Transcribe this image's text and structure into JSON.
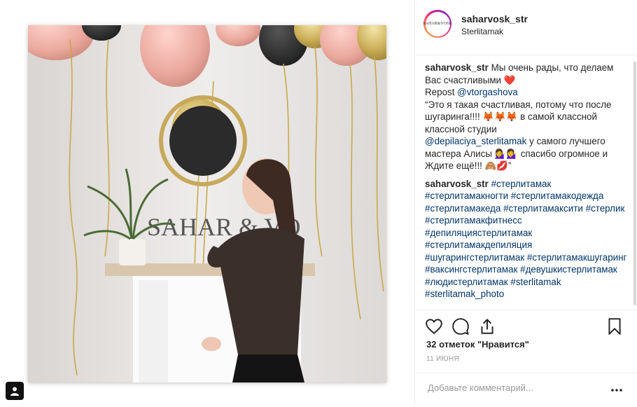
{
  "header": {
    "username": "saharvosk_str",
    "location": "Sterlitamak",
    "avatar_text": "SAHAR&VOSK"
  },
  "photo": {
    "sign_text": "SAHAR & VO"
  },
  "caption": {
    "username": "saharvosk_str",
    "line1": "Мы очень рады, что делаем Вас счастливыми ❤️",
    "repost_prefix": "Repost",
    "repost_handle": "@vtorgashova",
    "quote_part1": "“Это я такая счастливая, потому что после шугаринга!!!! 🦊🦊🦊 в самой классной классной студии",
    "mention": "@depilaciya_sterlitamak",
    "quote_part2": "у самого лучшего мастера Алисы 💁‍♀️💁‍♀️ спасибо огромное и Ждите ещё!!! 🙈💋”"
  },
  "hashtags_comment": {
    "username": "saharvosk_str",
    "tags": [
      "#стерлитамак",
      "#стерлитамакногти",
      "#стерлитамакодежда",
      "#стерлитамакеда",
      "#стерлитамаксити",
      "#стерлик",
      "#стерлитамакфитнесс",
      "#депиляциястерлитамак",
      "#стерлитамакдепиляция",
      "#шугарингстерлитамак",
      "#стерлитамакшугаринг",
      "#ваксингстерлитамак",
      "#девушкистерлитамак",
      "#людистерлитамак",
      "#sterlitamak",
      "#sterlitamak_photo"
    ]
  },
  "likes_text": "32 отметок \"Нравится\"",
  "date_text": "11 ИЮНЯ",
  "add_comment": {
    "placeholder": "Добавьте комментарий..."
  },
  "icons": {
    "like": "heart-icon",
    "comment": "comment-icon",
    "share": "share-icon",
    "save": "bookmark-icon",
    "more": "more-dots-icon",
    "user": "user-tag-icon"
  }
}
